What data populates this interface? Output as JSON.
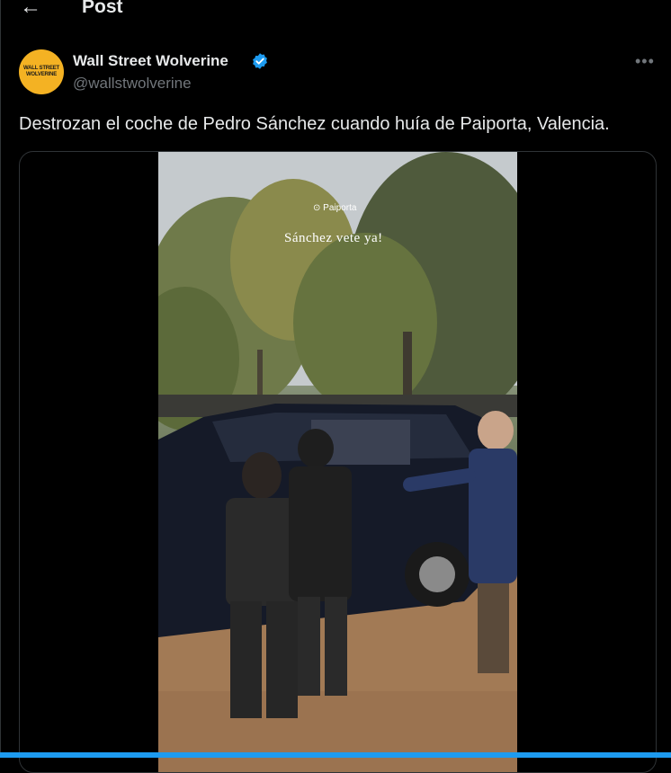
{
  "header": {
    "title": "Post",
    "back_icon": "arrow-left-icon"
  },
  "author": {
    "name": "Wall Street Wolverine",
    "handle": "@wallstwolverine",
    "avatar_text_1": "WALL STREET",
    "avatar_text_2": "WOLVERINE",
    "verified": true,
    "verified_color": "#1d9bf0",
    "more_label": "•••"
  },
  "tweet": {
    "text": "Destrozan el coche de Pedro Sánchez cuando huía de Paiporta, Valencia."
  },
  "video": {
    "location_label": "Paiporta",
    "overlay_text": "Sánchez vete ya!"
  },
  "colors": {
    "background": "#000000",
    "text": "#e7e9ea",
    "secondary": "#71767b",
    "accent": "#1d9bf0",
    "avatar_bg": "#f4b223"
  }
}
